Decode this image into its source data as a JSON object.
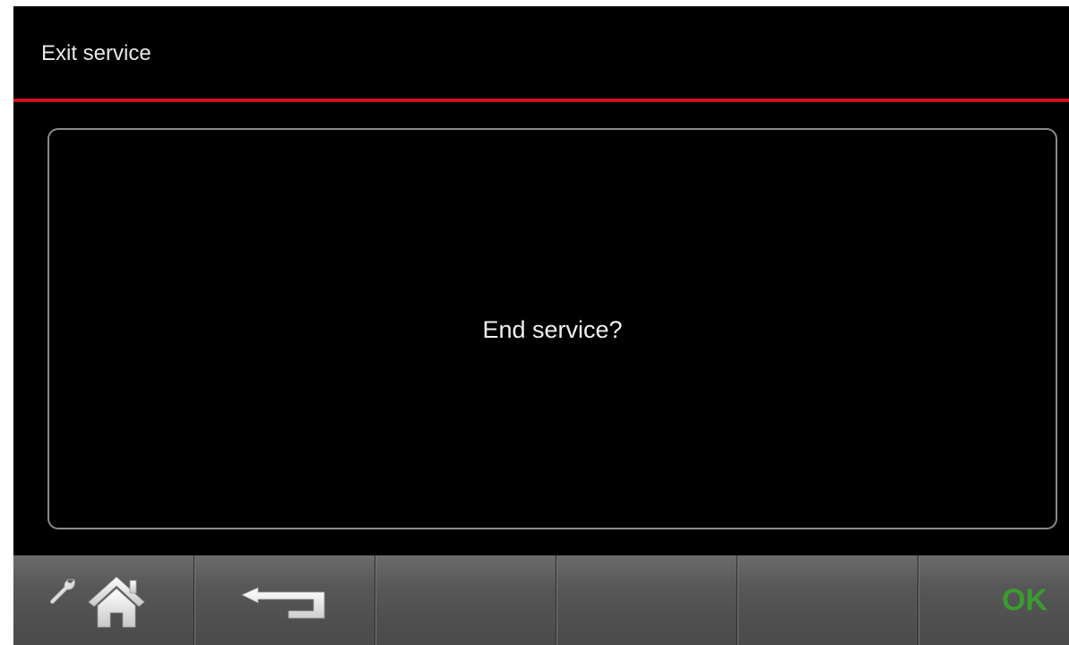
{
  "header": {
    "title": "Exit service"
  },
  "dialog": {
    "message": "End service?"
  },
  "softkeys": {
    "ok_label": "OK"
  },
  "icons": {
    "service_home": "wrench-home-icon",
    "back": "back-arrow-icon"
  },
  "colors": {
    "accent_rule": "#d0101c",
    "ok_text": "#3a9c2e",
    "background": "#000000"
  }
}
